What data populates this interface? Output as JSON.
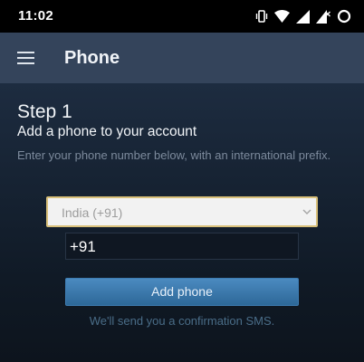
{
  "status_bar": {
    "time": "11:02",
    "icons": [
      "vibrate-icon",
      "wifi-icon",
      "signal-icon",
      "signal-no-data-icon",
      "battery-charging-icon"
    ]
  },
  "app_bar": {
    "title": "Phone",
    "menu_icon": "hamburger-menu-icon"
  },
  "content": {
    "step_title": "Step 1",
    "step_subtitle": "Add a phone to your account",
    "help_text": "Enter your phone number below, with an international prefix.",
    "country_select": {
      "selected": "India (+91)"
    },
    "phone_input": {
      "value": "+91"
    },
    "add_button_label": "Add phone",
    "sms_note": "We'll send you a confirmation SMS."
  },
  "colors": {
    "app_bar": "#34445b",
    "background": "#1b2a3e",
    "select_border": "#d9c07a",
    "button": "#3b78ab"
  }
}
